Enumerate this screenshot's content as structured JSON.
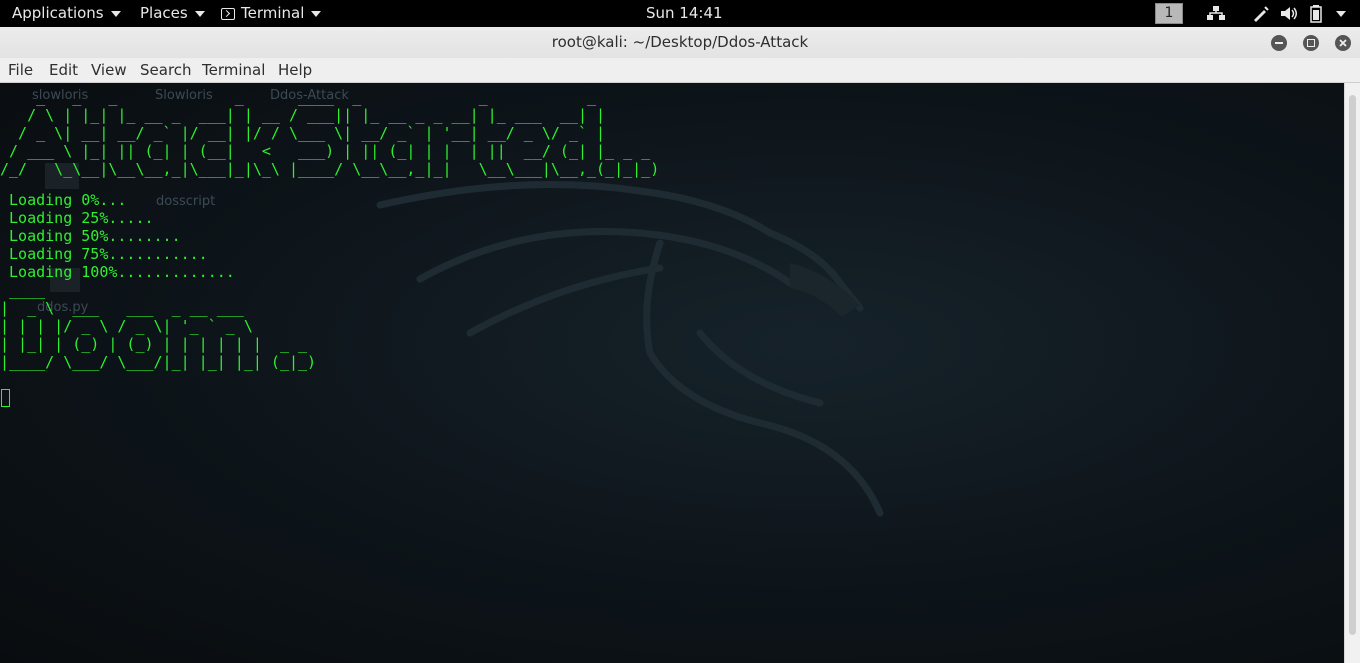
{
  "topbar": {
    "applications": "Applications",
    "places": "Places",
    "terminal": "Terminal",
    "clock": "Sun 14:41",
    "workspace": "1"
  },
  "window": {
    "title": "root@kali: ~/Desktop/Ddos-Attack"
  },
  "menu": [
    "File",
    "Edit",
    "View",
    "Search",
    "Terminal",
    "Help"
  ],
  "desktop_labels": {
    "slowloris_1": "slowloris",
    "slowloris_2": "Slowloris",
    "ddos_attack": "Ddos-Attack",
    "dosscript": "dosscript",
    "ddos_py": "ddos.py"
  },
  "terminal": {
    "banner_attack_started": "    _   _   _             _      ____  _             _           _\n   / \\ | |_| |_ __ _  ___| | __ / ___|| |_ __ _ _ __| |_ ___  __| |\n  / _ \\| __| __/ _` |/ __| |/ / \\___ \\| __/ _` | '__| __/ _ \\/ _` |\n / ___ \\ |_| || (_| | (__|   <   ___) | || (_| | |  | ||  __/ (_| |_ _ _\n/_/   \\_\\__|\\__\\__,_|\\___|_|\\_\\ |____/ \\__\\__,_|_|   \\__\\___|\\__,_(_|_|_)",
    "loading": [
      " Loading 0%...",
      " Loading 25%.....",
      " Loading 50%........",
      " Loading 75%...........",
      " Loading 100%............."
    ],
    "banner_doom": " ____\n|  _ \\  ___   ___  _ __ ___\n| | | |/ _ \\ / _ \\| '_ ` _ \\\n| |_| | (_) | (_) | | | | | |  _ _\n|____/ \\___/ \\___/|_| |_| |_| (_|_)"
  },
  "colors": {
    "terminal_text": "#2ef02e",
    "terminal_bg": "#0b0f12",
    "topbar_bg": "#000000"
  },
  "icons": [
    "chevron-down-icon",
    "terminal-icon",
    "network-icon",
    "pen-icon",
    "volume-icon",
    "battery-icon",
    "minimize-icon",
    "maximize-icon",
    "close-icon",
    "kali-dragon-icon"
  ]
}
